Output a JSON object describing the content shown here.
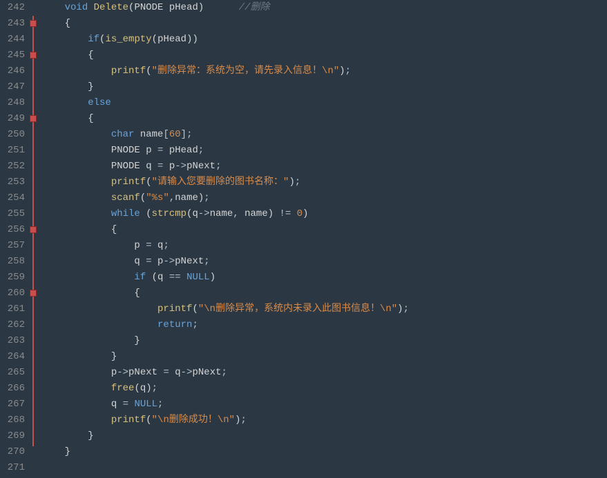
{
  "lineStart": 242,
  "lineEnd": 271,
  "foldMarkers": [
    243,
    245,
    249,
    256,
    260
  ],
  "foldLineTop": 23,
  "foldLineHeight": 624,
  "code": [
    {
      "n": 242,
      "segs": [
        {
          "t": "    ",
          "c": ""
        },
        {
          "t": "void",
          "c": "kw"
        },
        {
          "t": " ",
          "c": ""
        },
        {
          "t": "Delete",
          "c": "fn"
        },
        {
          "t": "(",
          "c": "paren"
        },
        {
          "t": "PNODE pHead",
          "c": "id"
        },
        {
          "t": ")",
          "c": "paren"
        },
        {
          "t": "      ",
          "c": ""
        },
        {
          "t": "//删除",
          "c": "cmt"
        }
      ]
    },
    {
      "n": 243,
      "segs": [
        {
          "t": "    ",
          "c": ""
        },
        {
          "t": "{",
          "c": "brace"
        }
      ]
    },
    {
      "n": 244,
      "segs": [
        {
          "t": "        ",
          "c": ""
        },
        {
          "t": "if",
          "c": "kw"
        },
        {
          "t": "(",
          "c": "paren"
        },
        {
          "t": "is_empty",
          "c": "fn"
        },
        {
          "t": "(",
          "c": "paren"
        },
        {
          "t": "pHead",
          "c": "id"
        },
        {
          "t": "))",
          "c": "paren"
        }
      ]
    },
    {
      "n": 245,
      "segs": [
        {
          "t": "        ",
          "c": ""
        },
        {
          "t": "{",
          "c": "brace"
        }
      ]
    },
    {
      "n": 246,
      "segs": [
        {
          "t": "            ",
          "c": ""
        },
        {
          "t": "printf",
          "c": "fn"
        },
        {
          "t": "(",
          "c": "paren"
        },
        {
          "t": "\"删除异常：系统为空，请先录入信息！\\n\"",
          "c": "str"
        },
        {
          "t": ")",
          "c": "paren"
        },
        {
          "t": ";",
          "c": "op"
        }
      ]
    },
    {
      "n": 247,
      "segs": [
        {
          "t": "        ",
          "c": ""
        },
        {
          "t": "}",
          "c": "brace"
        }
      ]
    },
    {
      "n": 248,
      "segs": [
        {
          "t": "        ",
          "c": ""
        },
        {
          "t": "else",
          "c": "kw"
        }
      ]
    },
    {
      "n": 249,
      "segs": [
        {
          "t": "        ",
          "c": ""
        },
        {
          "t": "{",
          "c": "brace"
        }
      ]
    },
    {
      "n": 250,
      "segs": [
        {
          "t": "            ",
          "c": ""
        },
        {
          "t": "char",
          "c": "kw"
        },
        {
          "t": " name",
          "c": "id"
        },
        {
          "t": "[",
          "c": "op"
        },
        {
          "t": "60",
          "c": "num"
        },
        {
          "t": "]",
          "c": "op"
        },
        {
          "t": ";",
          "c": "op"
        }
      ]
    },
    {
      "n": 251,
      "segs": [
        {
          "t": "            PNODE p ",
          "c": "id"
        },
        {
          "t": "=",
          "c": "op"
        },
        {
          "t": " pHead",
          "c": "id"
        },
        {
          "t": ";",
          "c": "op"
        }
      ]
    },
    {
      "n": 252,
      "segs": [
        {
          "t": "            PNODE q ",
          "c": "id"
        },
        {
          "t": "=",
          "c": "op"
        },
        {
          "t": " p",
          "c": "id"
        },
        {
          "t": "->",
          "c": "op"
        },
        {
          "t": "pNext",
          "c": "id"
        },
        {
          "t": ";",
          "c": "op"
        }
      ]
    },
    {
      "n": 253,
      "segs": [
        {
          "t": "            ",
          "c": ""
        },
        {
          "t": "printf",
          "c": "fn"
        },
        {
          "t": "(",
          "c": "paren"
        },
        {
          "t": "\"请输入您要删除的图书名称：\"",
          "c": "str"
        },
        {
          "t": ")",
          "c": "paren"
        },
        {
          "t": ";",
          "c": "op"
        }
      ]
    },
    {
      "n": 254,
      "segs": [
        {
          "t": "            ",
          "c": ""
        },
        {
          "t": "scanf",
          "c": "fn"
        },
        {
          "t": "(",
          "c": "paren"
        },
        {
          "t": "\"",
          "c": "str"
        },
        {
          "t": "%s",
          "c": "fmt"
        },
        {
          "t": "\"",
          "c": "str"
        },
        {
          "t": ",",
          "c": "op"
        },
        {
          "t": "name",
          "c": "id"
        },
        {
          "t": ")",
          "c": "paren"
        },
        {
          "t": ";",
          "c": "op"
        }
      ]
    },
    {
      "n": 255,
      "segs": [
        {
          "t": "            ",
          "c": ""
        },
        {
          "t": "while",
          "c": "kw"
        },
        {
          "t": " (",
          "c": "paren"
        },
        {
          "t": "strcmp",
          "c": "fn"
        },
        {
          "t": "(",
          "c": "paren"
        },
        {
          "t": "q",
          "c": "id"
        },
        {
          "t": "->",
          "c": "op"
        },
        {
          "t": "name",
          "c": "id"
        },
        {
          "t": ", ",
          "c": "op"
        },
        {
          "t": "name",
          "c": "id"
        },
        {
          "t": ") ",
          "c": "paren"
        },
        {
          "t": "!=",
          "c": "op"
        },
        {
          "t": " ",
          "c": ""
        },
        {
          "t": "0",
          "c": "num"
        },
        {
          "t": ")",
          "c": "paren"
        }
      ]
    },
    {
      "n": 256,
      "segs": [
        {
          "t": "            ",
          "c": ""
        },
        {
          "t": "{",
          "c": "brace"
        }
      ]
    },
    {
      "n": 257,
      "segs": [
        {
          "t": "                p ",
          "c": "id"
        },
        {
          "t": "=",
          "c": "op"
        },
        {
          "t": " q",
          "c": "id"
        },
        {
          "t": ";",
          "c": "op"
        }
      ]
    },
    {
      "n": 258,
      "segs": [
        {
          "t": "                q ",
          "c": "id"
        },
        {
          "t": "=",
          "c": "op"
        },
        {
          "t": " p",
          "c": "id"
        },
        {
          "t": "->",
          "c": "op"
        },
        {
          "t": "pNext",
          "c": "id"
        },
        {
          "t": ";",
          "c": "op"
        }
      ]
    },
    {
      "n": 259,
      "segs": [
        {
          "t": "                ",
          "c": ""
        },
        {
          "t": "if",
          "c": "kw"
        },
        {
          "t": " (",
          "c": "paren"
        },
        {
          "t": "q ",
          "c": "id"
        },
        {
          "t": "==",
          "c": "op"
        },
        {
          "t": " ",
          "c": ""
        },
        {
          "t": "NULL",
          "c": "kw"
        },
        {
          "t": ")",
          "c": "paren"
        }
      ]
    },
    {
      "n": 260,
      "segs": [
        {
          "t": "                ",
          "c": ""
        },
        {
          "t": "{",
          "c": "brace"
        }
      ]
    },
    {
      "n": 261,
      "segs": [
        {
          "t": "                    ",
          "c": ""
        },
        {
          "t": "printf",
          "c": "fn"
        },
        {
          "t": "(",
          "c": "paren"
        },
        {
          "t": "\"\\n删除异常，系统内未录入此图书信息！\\n\"",
          "c": "str"
        },
        {
          "t": ")",
          "c": "paren"
        },
        {
          "t": ";",
          "c": "op"
        }
      ]
    },
    {
      "n": 262,
      "segs": [
        {
          "t": "                    ",
          "c": ""
        },
        {
          "t": "return",
          "c": "kw"
        },
        {
          "t": ";",
          "c": "op"
        }
      ]
    },
    {
      "n": 263,
      "segs": [
        {
          "t": "                ",
          "c": ""
        },
        {
          "t": "}",
          "c": "brace"
        }
      ]
    },
    {
      "n": 264,
      "segs": [
        {
          "t": "            ",
          "c": ""
        },
        {
          "t": "}",
          "c": "brace"
        }
      ]
    },
    {
      "n": 265,
      "segs": [
        {
          "t": "            p",
          "c": "id"
        },
        {
          "t": "->",
          "c": "op"
        },
        {
          "t": "pNext ",
          "c": "id"
        },
        {
          "t": "=",
          "c": "op"
        },
        {
          "t": " q",
          "c": "id"
        },
        {
          "t": "->",
          "c": "op"
        },
        {
          "t": "pNext",
          "c": "id"
        },
        {
          "t": ";",
          "c": "op"
        }
      ]
    },
    {
      "n": 266,
      "segs": [
        {
          "t": "            ",
          "c": ""
        },
        {
          "t": "free",
          "c": "fn"
        },
        {
          "t": "(",
          "c": "paren"
        },
        {
          "t": "q",
          "c": "id"
        },
        {
          "t": ")",
          "c": "paren"
        },
        {
          "t": ";",
          "c": "op"
        }
      ]
    },
    {
      "n": 267,
      "segs": [
        {
          "t": "            q ",
          "c": "id"
        },
        {
          "t": "=",
          "c": "op"
        },
        {
          "t": " ",
          "c": ""
        },
        {
          "t": "NULL",
          "c": "kw"
        },
        {
          "t": ";",
          "c": "op"
        }
      ]
    },
    {
      "n": 268,
      "segs": [
        {
          "t": "            ",
          "c": ""
        },
        {
          "t": "printf",
          "c": "fn"
        },
        {
          "t": "(",
          "c": "paren"
        },
        {
          "t": "\"\\n删除成功！\\n\"",
          "c": "str"
        },
        {
          "t": ")",
          "c": "paren"
        },
        {
          "t": ";",
          "c": "op"
        }
      ]
    },
    {
      "n": 269,
      "segs": [
        {
          "t": "        ",
          "c": ""
        },
        {
          "t": "}",
          "c": "brace"
        }
      ]
    },
    {
      "n": 270,
      "segs": [
        {
          "t": "    ",
          "c": ""
        },
        {
          "t": "}",
          "c": "brace"
        }
      ]
    },
    {
      "n": 271,
      "segs": [
        {
          "t": "",
          "c": ""
        }
      ]
    }
  ]
}
